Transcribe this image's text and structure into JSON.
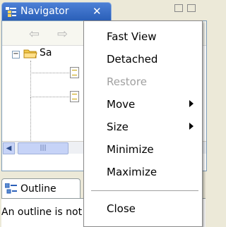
{
  "navigator_view": {
    "title": "Navigator",
    "tree_items": [
      {
        "label": "Sa",
        "type": "folder",
        "expanded": true
      }
    ]
  },
  "outline_view": {
    "title": "Outline",
    "message": "An outline is not available."
  },
  "view_menu": {
    "items": [
      {
        "label": "Fast View",
        "enabled": true,
        "submenu": false
      },
      {
        "label": "Detached",
        "enabled": true,
        "submenu": false
      },
      {
        "label": "Restore",
        "enabled": false,
        "submenu": false
      },
      {
        "label": "Move",
        "enabled": true,
        "submenu": true
      },
      {
        "label": "Size",
        "enabled": true,
        "submenu": true
      },
      {
        "label": "Minimize",
        "enabled": true,
        "submenu": false
      },
      {
        "label": "Maximize",
        "enabled": true,
        "submenu": false
      },
      {
        "label": "Close",
        "enabled": true,
        "submenu": false
      }
    ]
  },
  "icons": {
    "tab_close": "close-icon",
    "back": "back-arrow-icon",
    "forward": "forward-arrow-icon"
  },
  "colors": {
    "active_tab": "#2a5fb8",
    "menu_background": "#ffffff",
    "disabled_text": "#a0a0a0"
  }
}
